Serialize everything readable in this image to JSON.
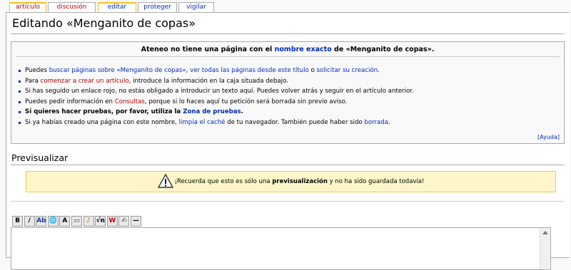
{
  "tabs": [
    {
      "label": "artículo",
      "state": "selected-new"
    },
    {
      "label": "discusión",
      "state": "new"
    },
    {
      "label": "editar",
      "state": "selected"
    },
    {
      "label": "proteger",
      "state": "normal"
    },
    {
      "label": "vigilar",
      "state": "normal"
    }
  ],
  "page_title": "Editando «Menganito de copas»",
  "notice": {
    "heading": {
      "before": "Ateneo no tiene una página con el ",
      "link": "nombre exacto",
      "after": " de «Menganito de copas»."
    },
    "items": [
      {
        "parts": [
          [
            "t",
            "Puedes "
          ],
          [
            "l",
            "buscar páginas sobre «Menganito de copas»"
          ],
          [
            "t",
            ", "
          ],
          [
            "l",
            "ver todas las páginas desde este título"
          ],
          [
            "t",
            " o "
          ],
          [
            "l",
            "solicitar su creación"
          ],
          [
            "t",
            "."
          ]
        ]
      },
      {
        "parts": [
          [
            "t",
            "Para "
          ],
          [
            "n",
            "comenzar a crear un artículo"
          ],
          [
            "t",
            ", introduce la información en la caja situada debajo."
          ]
        ]
      },
      {
        "parts": [
          [
            "t",
            "Si has seguido un enlace rojo, no estás obligado a introducir un texto aquí. Puedes volver atrás y seguir en el artículo anterior."
          ]
        ]
      },
      {
        "parts": [
          [
            "t",
            "Puedes pedir información en "
          ],
          [
            "n",
            "Consultas"
          ],
          [
            "t",
            ", porque si lo haces aquí tu petición será borrada sin previo aviso."
          ]
        ]
      },
      {
        "parts": [
          [
            "b",
            "Si quieres hacer pruebas, por favor, utiliza la "
          ],
          [
            "bl",
            "Zona de pruebas"
          ],
          [
            "b",
            "."
          ]
        ]
      },
      {
        "parts": [
          [
            "t",
            "Si ya habías creado una página con este nombre, "
          ],
          [
            "l",
            "limpia el caché"
          ],
          [
            "t",
            " de tu navegador. También puede haber sido "
          ],
          [
            "l",
            "borrada"
          ],
          [
            "t",
            "."
          ]
        ]
      }
    ],
    "help_link": "[Ayuda]"
  },
  "preview_heading": "Previsualizar",
  "preview_notice": {
    "before": "¡Recuerda que esto es sólo una ",
    "bold": "previsualización",
    "after": " y no ha sido guardada todavía!"
  },
  "toolbar": [
    {
      "name": "bold-button",
      "glyph": "B"
    },
    {
      "name": "italic-button",
      "glyph": "/"
    },
    {
      "name": "internal-link-button",
      "glyph": "Ab"
    },
    {
      "name": "external-link-button",
      "glyph": "🌐"
    },
    {
      "name": "headline-button",
      "glyph": "A"
    },
    {
      "name": "image-button",
      "glyph": "▭"
    },
    {
      "name": "media-button",
      "glyph": "♪"
    },
    {
      "name": "math-button",
      "glyph": "√n"
    },
    {
      "name": "nowiki-button",
      "glyph": "W"
    },
    {
      "name": "signature-button",
      "glyph": "✍"
    },
    {
      "name": "horizontal-line-button",
      "glyph": "—"
    }
  ],
  "colors": {
    "link": "#002bb8",
    "new_link": "#ba0000",
    "preview_bg": "#fef6c8"
  }
}
